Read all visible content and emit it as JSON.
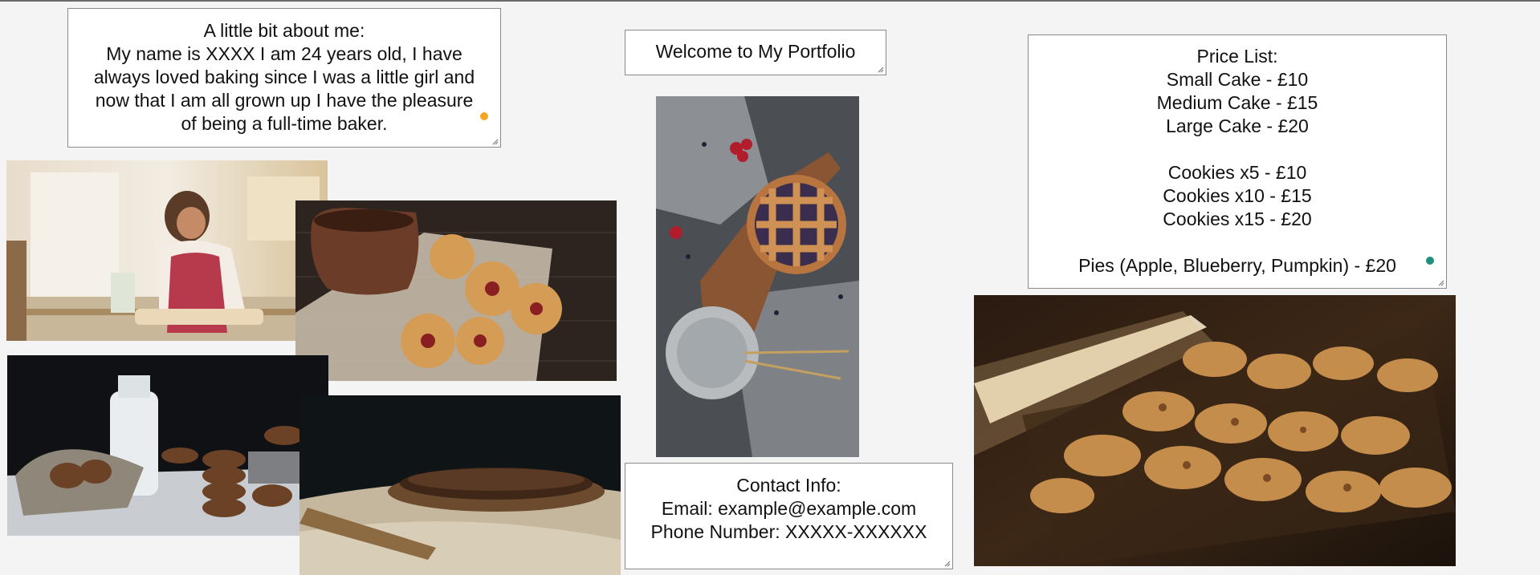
{
  "about": {
    "heading": "A little bit about me:",
    "lines": [
      "My name is XXXX I am 24 years old, I have",
      "always loved baking since I was a little girl and",
      "now that I am all grown up I have the pleasure",
      "of being a full-time baker."
    ],
    "dot_color": "#f5a623"
  },
  "welcome": {
    "title": "Welcome to My Portfolio"
  },
  "prices": {
    "heading": "Price List:",
    "lines": [
      "Small Cake - £10",
      "Medium Cake - £15",
      "Large Cake - £20",
      "",
      "Cookies x5 - £10",
      "Cookies x10 - £15",
      "Cookies x15 - £20",
      "",
      "Pies (Apple, Blueberry, Pumpkin) - £20"
    ],
    "dot_color": "#1f8f7e"
  },
  "contact": {
    "heading": "Contact Info:",
    "email_line": "Email: example@example.com",
    "phone_line": "Phone Number: XXXXX-XXXXXX"
  },
  "photos": [
    {
      "name": "baker-woman-photo",
      "subject": "woman baking in kitchen"
    },
    {
      "name": "jam-cookies-photo",
      "subject": "jam cookies with clay mug"
    },
    {
      "name": "lattice-pie-photo",
      "subject": "lattice berry pie on board"
    },
    {
      "name": "milk-cookies-photo",
      "subject": "chocolate chip cookies with milk bottle"
    },
    {
      "name": "chocolate-tart-photo",
      "subject": "chocolate tart on wooden stand"
    },
    {
      "name": "oven-pastries-photo",
      "subject": "pastries baking in oven"
    }
  ]
}
